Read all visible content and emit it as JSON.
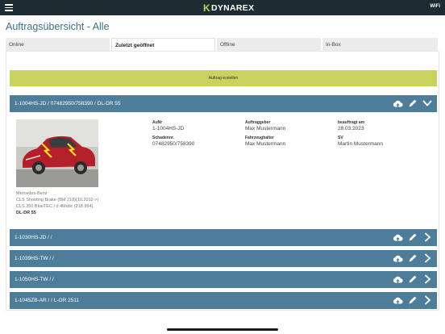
{
  "app": {
    "logo_k": "K",
    "logo_rest": "DYNAREX",
    "wifi": "WiFi"
  },
  "page": {
    "title": "Auftragsübersicht - Alle"
  },
  "tabs": [
    {
      "label": "Online"
    },
    {
      "label": "Zuletzt geöffnet",
      "active": true
    },
    {
      "label": "Offline"
    },
    {
      "label": "In-Box"
    }
  ],
  "create_button": {
    "label": "Auftrag erstellen"
  },
  "orders": [
    {
      "title": "1-1004HS-JD / 07482950/758390 / DL-DR 55",
      "expanded": true,
      "vehicle": {
        "make": "Mercedes-Benz",
        "model": "CLS Shooting Brake (BM 218)(10.2012->)",
        "variant": "CLS 350 BlueTEC / d 4Matic (218.994)",
        "plate": "DL-DR 55"
      },
      "fields": {
        "aunr_label": "AuNr",
        "aunr": "1-1004HS-JD",
        "schadennr_label": "Schadennr.",
        "schadennr": "07482950/758390",
        "auftraggeber_label": "Auftraggeber",
        "auftraggeber": "Max Mustermann",
        "fahrzeughalter_label": "Fahrzeughalter",
        "fahrzeughalter": "Max Mustermann",
        "beauftragt_label": "beauftragt am",
        "beauftragt": "28.03.2023",
        "sv_label": "SV",
        "sv": "Martin Mustermann"
      }
    },
    {
      "title": "1-1030HS-JD / /"
    },
    {
      "title": "1-1039HS-TW / /"
    },
    {
      "title": "1-1050HS-TW / /"
    },
    {
      "title": "1-1045ZB-AR / / L-OR 2511"
    }
  ],
  "colors": {
    "topbar": "#1d2b33",
    "accent": "#c9d25e",
    "header": "#4e7d9a",
    "title": "#3f6f8d"
  },
  "icons": [
    "menu-icon",
    "cloud-upload-icon",
    "edit-pencil-icon",
    "chevron-down-icon",
    "chevron-right-icon"
  ]
}
